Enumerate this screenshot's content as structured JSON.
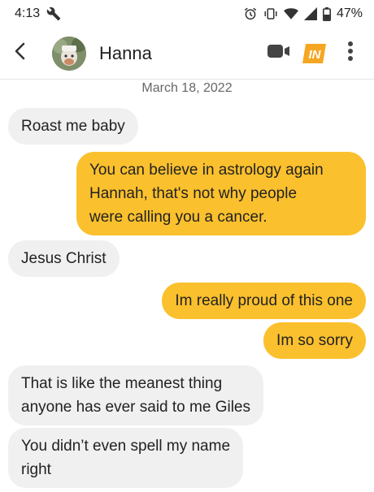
{
  "status_bar": {
    "time": "4:13",
    "battery": "47%",
    "icons": [
      "wrench-icon",
      "alarm-icon",
      "vibrate-icon",
      "wifi-icon",
      "signal-icon",
      "battery-icon"
    ]
  },
  "header": {
    "contact_name": "Hanna",
    "back_icon": "chevron-left-icon",
    "video_icon": "video-call-icon",
    "badge_text": "IN",
    "menu_icon": "more-vertical-icon"
  },
  "conversation": {
    "date": "March 18, 2022",
    "messages": [
      {
        "direction": "incoming",
        "text": "Roast me baby"
      },
      {
        "direction": "outgoing",
        "text": "You can believe in astrology again\nHannah, that's not why people\nwere calling you a cancer."
      },
      {
        "direction": "incoming",
        "text": "Jesus Christ"
      },
      {
        "direction": "outgoing",
        "text": "Im really proud of this one"
      },
      {
        "direction": "outgoing",
        "text": "Im so sorry"
      },
      {
        "direction": "incoming",
        "text": "That is like the meanest thing\nanyone has ever said to me Giles"
      },
      {
        "direction": "incoming",
        "text": "You didn’t even spell my name\nright"
      }
    ]
  },
  "colors": {
    "outgoing_bubble": "#fbc02d",
    "incoming_bubble": "#f0f0f0",
    "badge": "#f5a623"
  }
}
